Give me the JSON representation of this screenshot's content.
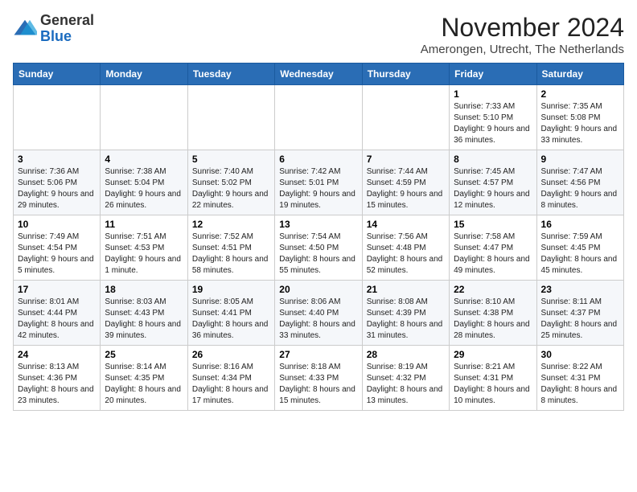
{
  "logo": {
    "general": "General",
    "blue": "Blue"
  },
  "title": "November 2024",
  "subtitle": "Amerongen, Utrecht, The Netherlands",
  "days_of_week": [
    "Sunday",
    "Monday",
    "Tuesday",
    "Wednesday",
    "Thursday",
    "Friday",
    "Saturday"
  ],
  "weeks": [
    [
      {
        "day": "",
        "info": ""
      },
      {
        "day": "",
        "info": ""
      },
      {
        "day": "",
        "info": ""
      },
      {
        "day": "",
        "info": ""
      },
      {
        "day": "",
        "info": ""
      },
      {
        "day": "1",
        "info": "Sunrise: 7:33 AM\nSunset: 5:10 PM\nDaylight: 9 hours and 36 minutes."
      },
      {
        "day": "2",
        "info": "Sunrise: 7:35 AM\nSunset: 5:08 PM\nDaylight: 9 hours and 33 minutes."
      }
    ],
    [
      {
        "day": "3",
        "info": "Sunrise: 7:36 AM\nSunset: 5:06 PM\nDaylight: 9 hours and 29 minutes."
      },
      {
        "day": "4",
        "info": "Sunrise: 7:38 AM\nSunset: 5:04 PM\nDaylight: 9 hours and 26 minutes."
      },
      {
        "day": "5",
        "info": "Sunrise: 7:40 AM\nSunset: 5:02 PM\nDaylight: 9 hours and 22 minutes."
      },
      {
        "day": "6",
        "info": "Sunrise: 7:42 AM\nSunset: 5:01 PM\nDaylight: 9 hours and 19 minutes."
      },
      {
        "day": "7",
        "info": "Sunrise: 7:44 AM\nSunset: 4:59 PM\nDaylight: 9 hours and 15 minutes."
      },
      {
        "day": "8",
        "info": "Sunrise: 7:45 AM\nSunset: 4:57 PM\nDaylight: 9 hours and 12 minutes."
      },
      {
        "day": "9",
        "info": "Sunrise: 7:47 AM\nSunset: 4:56 PM\nDaylight: 9 hours and 8 minutes."
      }
    ],
    [
      {
        "day": "10",
        "info": "Sunrise: 7:49 AM\nSunset: 4:54 PM\nDaylight: 9 hours and 5 minutes."
      },
      {
        "day": "11",
        "info": "Sunrise: 7:51 AM\nSunset: 4:53 PM\nDaylight: 9 hours and 1 minute."
      },
      {
        "day": "12",
        "info": "Sunrise: 7:52 AM\nSunset: 4:51 PM\nDaylight: 8 hours and 58 minutes."
      },
      {
        "day": "13",
        "info": "Sunrise: 7:54 AM\nSunset: 4:50 PM\nDaylight: 8 hours and 55 minutes."
      },
      {
        "day": "14",
        "info": "Sunrise: 7:56 AM\nSunset: 4:48 PM\nDaylight: 8 hours and 52 minutes."
      },
      {
        "day": "15",
        "info": "Sunrise: 7:58 AM\nSunset: 4:47 PM\nDaylight: 8 hours and 49 minutes."
      },
      {
        "day": "16",
        "info": "Sunrise: 7:59 AM\nSunset: 4:45 PM\nDaylight: 8 hours and 45 minutes."
      }
    ],
    [
      {
        "day": "17",
        "info": "Sunrise: 8:01 AM\nSunset: 4:44 PM\nDaylight: 8 hours and 42 minutes."
      },
      {
        "day": "18",
        "info": "Sunrise: 8:03 AM\nSunset: 4:43 PM\nDaylight: 8 hours and 39 minutes."
      },
      {
        "day": "19",
        "info": "Sunrise: 8:05 AM\nSunset: 4:41 PM\nDaylight: 8 hours and 36 minutes."
      },
      {
        "day": "20",
        "info": "Sunrise: 8:06 AM\nSunset: 4:40 PM\nDaylight: 8 hours and 33 minutes."
      },
      {
        "day": "21",
        "info": "Sunrise: 8:08 AM\nSunset: 4:39 PM\nDaylight: 8 hours and 31 minutes."
      },
      {
        "day": "22",
        "info": "Sunrise: 8:10 AM\nSunset: 4:38 PM\nDaylight: 8 hours and 28 minutes."
      },
      {
        "day": "23",
        "info": "Sunrise: 8:11 AM\nSunset: 4:37 PM\nDaylight: 8 hours and 25 minutes."
      }
    ],
    [
      {
        "day": "24",
        "info": "Sunrise: 8:13 AM\nSunset: 4:36 PM\nDaylight: 8 hours and 23 minutes."
      },
      {
        "day": "25",
        "info": "Sunrise: 8:14 AM\nSunset: 4:35 PM\nDaylight: 8 hours and 20 minutes."
      },
      {
        "day": "26",
        "info": "Sunrise: 8:16 AM\nSunset: 4:34 PM\nDaylight: 8 hours and 17 minutes."
      },
      {
        "day": "27",
        "info": "Sunrise: 8:18 AM\nSunset: 4:33 PM\nDaylight: 8 hours and 15 minutes."
      },
      {
        "day": "28",
        "info": "Sunrise: 8:19 AM\nSunset: 4:32 PM\nDaylight: 8 hours and 13 minutes."
      },
      {
        "day": "29",
        "info": "Sunrise: 8:21 AM\nSunset: 4:31 PM\nDaylight: 8 hours and 10 minutes."
      },
      {
        "day": "30",
        "info": "Sunrise: 8:22 AM\nSunset: 4:31 PM\nDaylight: 8 hours and 8 minutes."
      }
    ]
  ]
}
